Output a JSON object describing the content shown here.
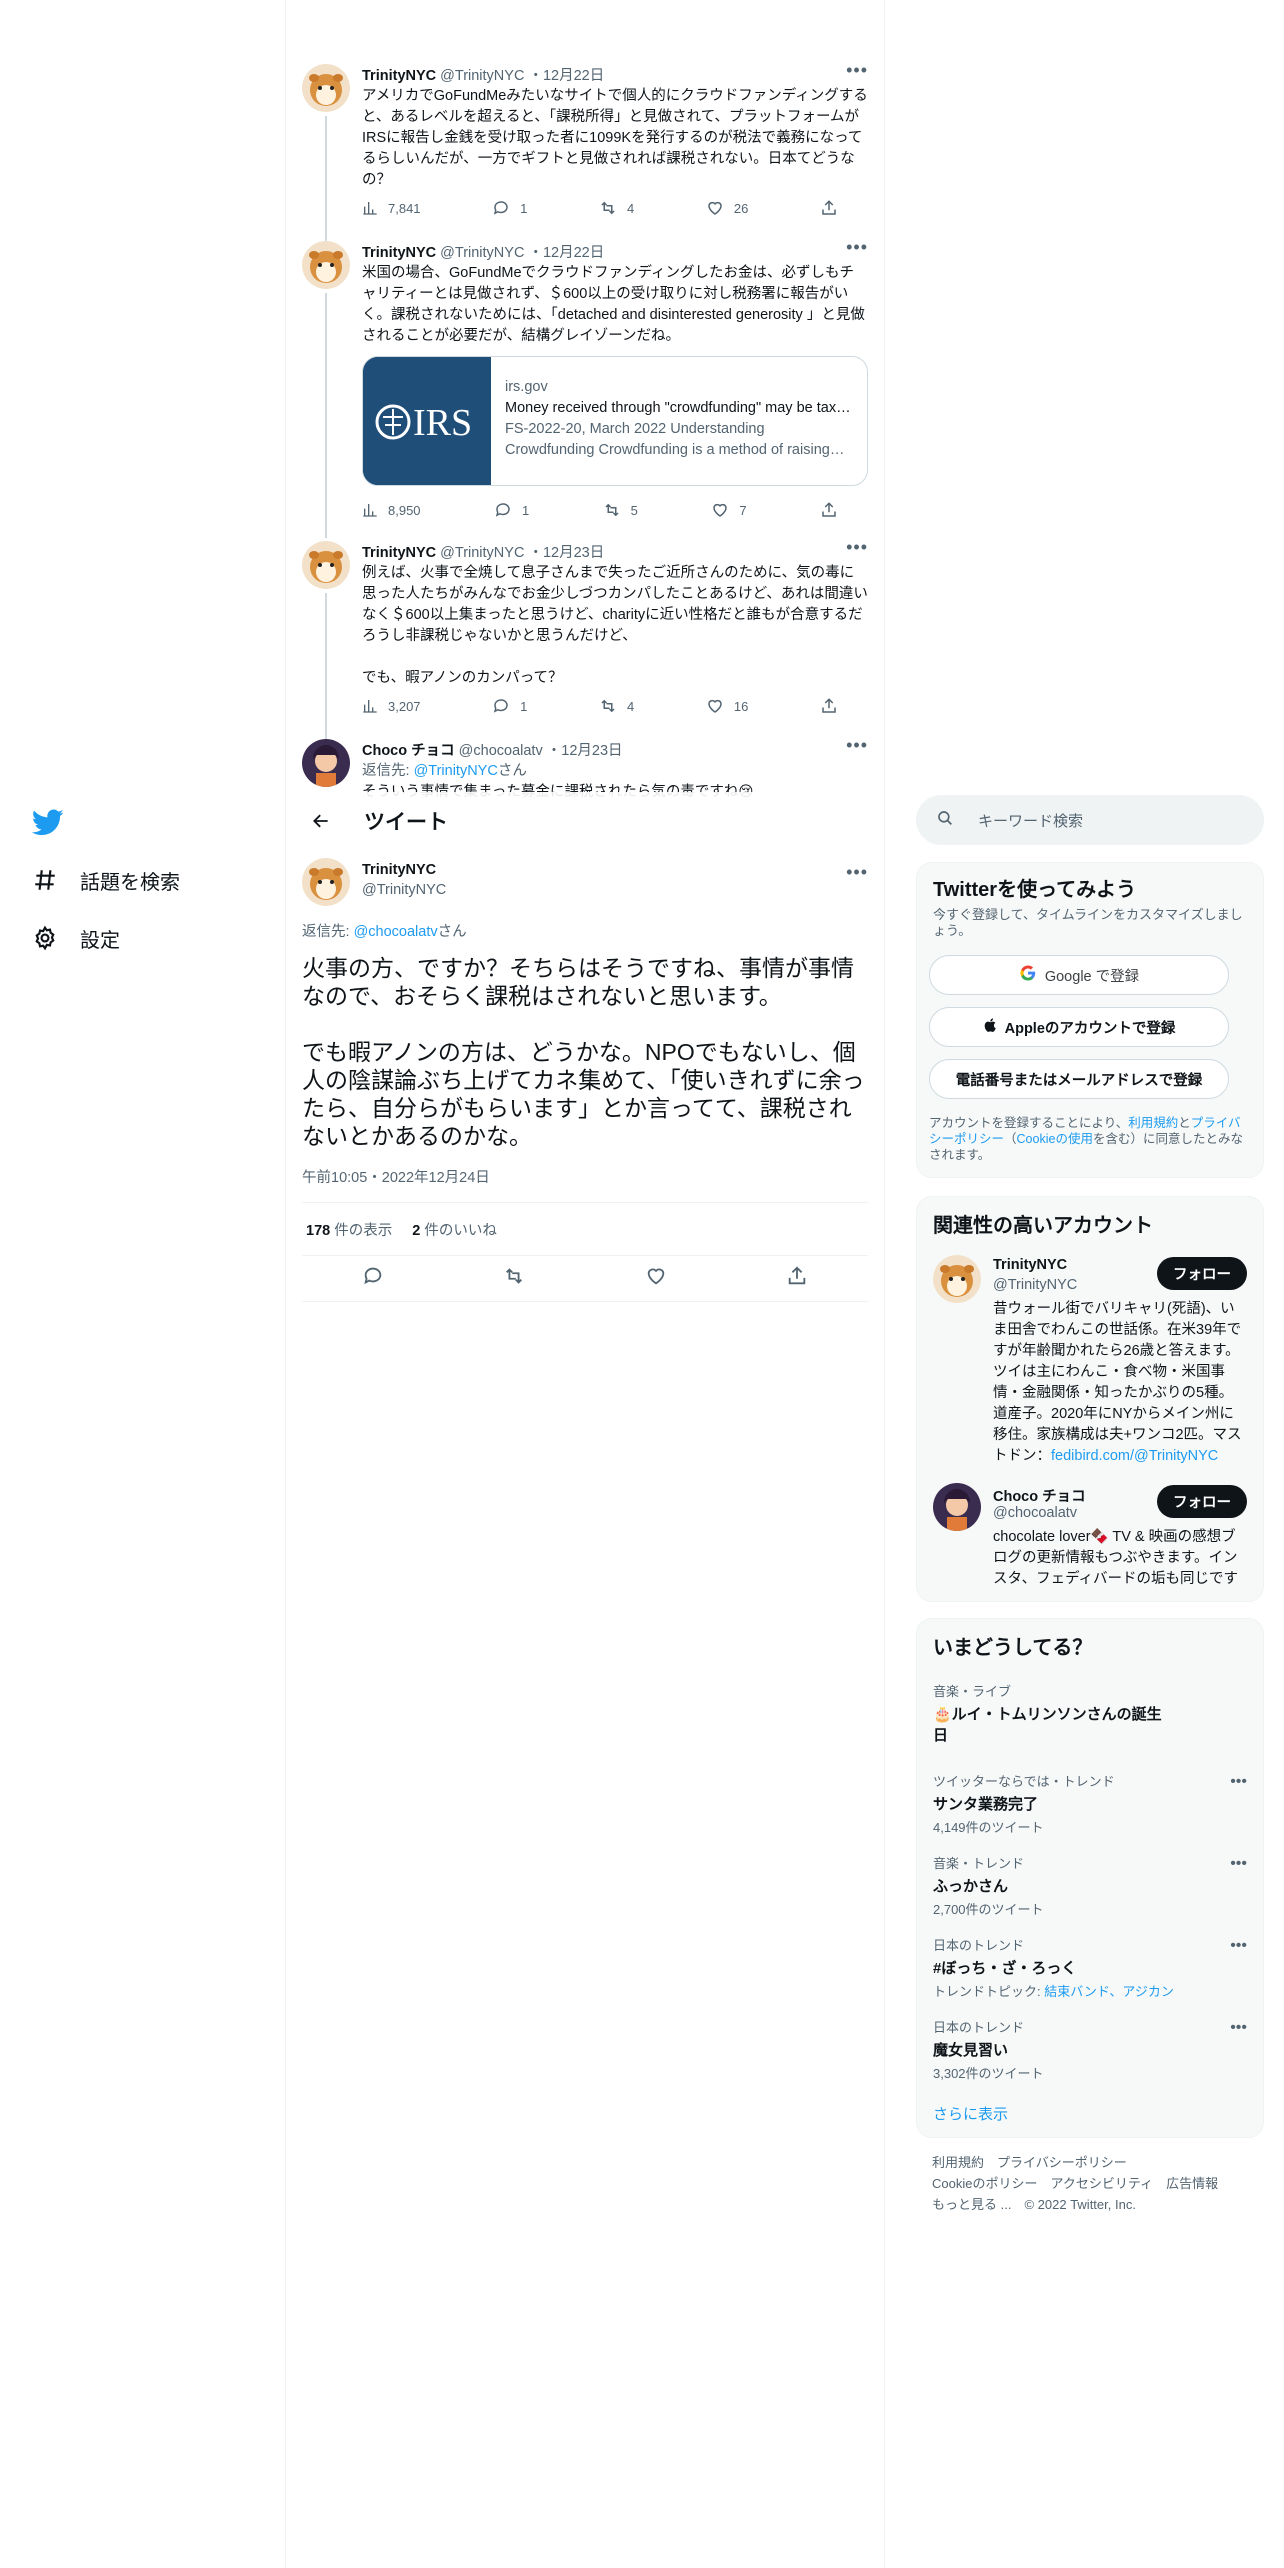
{
  "nav": {
    "explore_label": "話題を検索",
    "settings_label": "設定"
  },
  "thread": [
    {
      "name": "TrinityNYC",
      "handle": "@TrinityNYC",
      "date": "・12月22日",
      "text": "アメリカでGoFundMeみたいなサイトで個人的にクラウドファンディングすると、あるレベルを超えると、「課税所得」と見做されて、プラットフォームがIRSに報告し金銭を受け取った者に1099Kを発行するのが税法で義務になってるらしいんだが、一方でギフトと見做されれば課税されない。日本てどうなの？",
      "views": "7,841",
      "replies": "1",
      "retweets": "4",
      "likes": "26"
    },
    {
      "name": "TrinityNYC",
      "handle": "@TrinityNYC",
      "date": "・12月22日",
      "text": "米国の場合、GoFundMeでクラウドファンディングしたお金は、必ずしもチャリティーとは見做されず、＄600以上の受け取りに対し税務署に報告がいく。課税されないためには、「detached and disinterested generosity 」と見做されることが必要だが、結構グレイゾーンだね。",
      "card": {
        "logo_text": "IRS",
        "domain": "irs.gov",
        "title": "Money received through \"crowdfunding\" may be taxable",
        "description": "FS-2022-20, March 2022 Understanding Crowdfunding Crowdfunding is a method of raising money"
      },
      "views": "8,950",
      "replies": "1",
      "retweets": "5",
      "likes": "7"
    },
    {
      "name": "TrinityNYC",
      "handle": "@TrinityNYC",
      "date": "・12月23日",
      "text": "例えば、火事で全焼して息子さんまで失ったご近所さんのために、気の毒に思った人たちがみんなでお金少しづつカンパしたことあるけど、あれは間違いなく＄600以上集まったと思うけど、charityに近い性格だと誰もが合意するだろうし非課税じゃないかと思うんだけど、\n\nでも、暇アノンのカンパって？",
      "views": "3,207",
      "replies": "1",
      "retweets": "4",
      "likes": "16"
    },
    {
      "name": "Choco チョコ",
      "handle": "@chocoalatv",
      "date": "・12月23日",
      "reply_prefix": "返信先: ",
      "reply_to": "@TrinityNYC",
      "reply_suffix": "さん",
      "text": "そういう事情で集まった募金に課税されたら気の毒ですね😢"
    }
  ],
  "header": {
    "title": "ツイート"
  },
  "main_tweet": {
    "name": "TrinityNYC",
    "handle": "@TrinityNYC",
    "reply_prefix": "返信先: ",
    "reply_to": "@chocoalatv",
    "reply_suffix": "さん",
    "text": "火事の方、ですか？そちらはそうですね、事情が事情なので、おそらく課税はされないと思います。\n\nでも暇アノンの方は、どうかな。NPOでもないし、個人の陰謀論ぶち上げてカネ集めて、「使いきれずに余ったら、自分らがもらいます」とか言ってて、課税されないとかあるのかな。",
    "timestamp": "午前10:05・2022年12月24日",
    "views_count": "178",
    "views_label": " 件の表示",
    "likes_count": "2",
    "likes_label": " 件のいいね"
  },
  "search": {
    "placeholder": "キーワード検索"
  },
  "signup": {
    "title": "Twitterを使ってみよう",
    "subtitle": "今すぐ登録して、タイムラインをカスタマイズしましょう。",
    "google_label": "Google で登録",
    "apple_label": "Appleのアカウントで登録",
    "phone_label": "電話番号またはメールアドレスで登録",
    "legal_prefix": "アカウントを登録することにより、",
    "terms": "利用規約",
    "and": "と",
    "privacy": "プライバシーポリシー",
    "open_paren": "（",
    "cookie": "Cookieの使用",
    "legal_suffix": "を含む）に同意したとみなされます。"
  },
  "relevant": {
    "title": "関連性の高いアカウント",
    "follow_label": "フォロー",
    "accounts": [
      {
        "name": "TrinityNYC",
        "handle": "@TrinityNYC",
        "bio": "昔ウォール街でバリキャリ(死語)、いま田舎でわんこの世話係。在米39年ですが年齢聞かれたら26歳と答えます。ツイは主にわんこ・食べ物・米国事情・金融関係・知ったかぶりの5種。道産子。2020年にNYからメイン州に移住。家族構成は夫+ワンコ2匹。マストドン：",
        "bio_link": "fedibird.com/@TrinityNYC"
      },
      {
        "name": "Choco チョコ",
        "handle": "@chocoalatv",
        "bio": "chocolate lover🍫 TV & 映画の感想ブログの更新情報もつぶやきます。インスタ、フェディバードの垢も同じです"
      }
    ]
  },
  "trends": {
    "title": "いまどうしてる？",
    "items": [
      {
        "category": "音楽・ライブ",
        "title": "🎂ルイ・トムリンソンさんの誕生日",
        "count": ""
      },
      {
        "category": "ツイッターならでは・トレンド",
        "title": "サンタ業務完了",
        "count": "4,149件のツイート"
      },
      {
        "category": "音楽・トレンド",
        "title": "ふっかさん",
        "count": "2,700件のツイート"
      },
      {
        "category": "日本のトレンド",
        "title": "#ぼっち・ざ・ろっく",
        "count_prefix": "トレンドトピック: ",
        "count_link": "結束バンド、アジカン",
        "count": ""
      },
      {
        "category": "日本のトレンド",
        "title": "魔女見習い",
        "count": "3,302件のツイート"
      }
    ],
    "more_label": "さらに表示"
  },
  "footer": {
    "terms": "利用規約",
    "privacy": "プライバシーポリシー",
    "cookie": "Cookieのポリシー",
    "accessibility": "アクセシビリティ",
    "ads": "広告情報",
    "more": "もっと見る ...",
    "copyright": "© 2022 Twitter, Inc."
  },
  "colors": {
    "accent": "#1d9bf0",
    "text": "#0f1419",
    "muted": "#536471",
    "border": "#eff3f4",
    "panel": "#f7f9f9"
  }
}
